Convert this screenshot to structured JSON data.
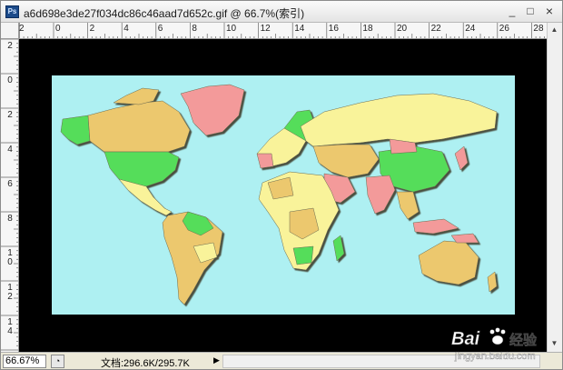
{
  "window": {
    "app_icon_label": "Ps",
    "title": "a6d698e3de27f034dc86c46aad7d652c.gif @ 66.7%(索引)",
    "controls": {
      "minimize": "_",
      "maximize": "□",
      "close": "×"
    }
  },
  "ruler": {
    "top_labels": [
      "0",
      "2",
      "4",
      "6",
      "8",
      "10",
      "12",
      "14",
      "16",
      "18",
      "20",
      "22",
      "24",
      "26",
      "28"
    ],
    "top_partial_left": "2",
    "left_labels": [
      "2",
      "0",
      "2",
      "4",
      "6",
      "8",
      "10",
      "12",
      "14"
    ]
  },
  "colors": {
    "ocean": "#aef0f2",
    "canvas_background": "#000000",
    "country_green": "#55dd5a",
    "country_yellow": "#f9f39a",
    "country_tan": "#ecc86e",
    "country_pink": "#f39a9a",
    "country_shadow": "#4b4b3a"
  },
  "status_bar": {
    "zoom": "66.67%",
    "doc_info": "文档:296.6K/295.7K",
    "arrow": "▶"
  },
  "watermark": {
    "brand": "Bai",
    "brand_tail": "经验",
    "url": "jingyan.baidu.com"
  }
}
